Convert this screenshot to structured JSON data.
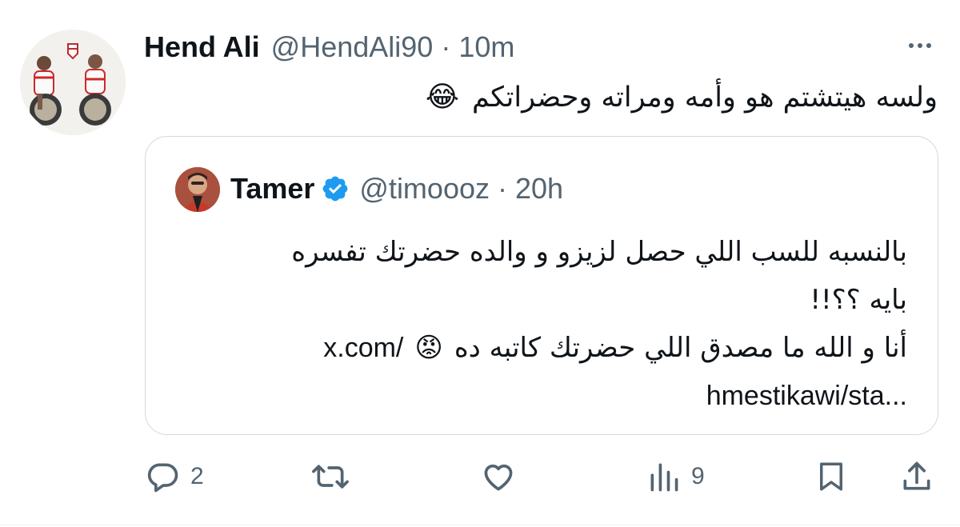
{
  "tweet": {
    "author_name": "Hend Ali",
    "author_handle": "@HendAli90",
    "separator": "·",
    "time": "10m",
    "text": "ولسه هيتشتم هو وأمه ومراته وحضراتكم",
    "emoji": "😂",
    "avatar_icon": "profile-photo-icon"
  },
  "quoted_tweet": {
    "author_name": "Tamer",
    "author_handle": "@timoooz",
    "separator": "·",
    "time": "20h",
    "verified": true,
    "verified_color": "#1d9bf0",
    "line1": "بالنسبه للسب اللي حصل لزيزو و والده حضرتك تفسره",
    "line2": "بايه ؟؟!!",
    "line3": "أنا و الله ما مصدق اللي حضرتك كاتبه ده",
    "line3_emoji": "😡",
    "link_part1": "x.com/",
    "link_part2": "hmestikawi/sta..."
  },
  "actions": {
    "reply_count": "2",
    "retweet_count": "",
    "like_count": "",
    "views_count": "9",
    "icons": [
      "reply-icon",
      "retweet-icon",
      "like-icon",
      "views-icon",
      "bookmark-icon",
      "share-icon"
    ]
  },
  "colors": {
    "text": "#0f1419",
    "secondary": "#536471",
    "border": "#cfd9de"
  }
}
